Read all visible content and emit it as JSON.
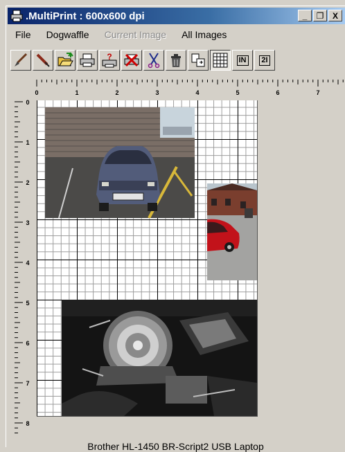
{
  "window": {
    "title": ".MultiPrint : 600x600 dpi",
    "minimize_glyph": "_",
    "restore_glyph": "❐",
    "close_glyph": "X"
  },
  "menu": {
    "items": [
      {
        "label": "File",
        "enabled": true
      },
      {
        "label": "Dogwaffle",
        "enabled": true
      },
      {
        "label": "Current Image",
        "enabled": false
      },
      {
        "label": "All Images",
        "enabled": true
      }
    ]
  },
  "toolbar": {
    "buttons": [
      {
        "icon": "brush-icon"
      },
      {
        "icon": "pen-icon"
      },
      {
        "icon": "open-folder-icon"
      },
      {
        "icon": "printer-icon"
      },
      {
        "icon": "print-setup-icon"
      },
      {
        "icon": "cancel-print-icon"
      },
      {
        "icon": "scissors-icon"
      },
      {
        "icon": "trash-icon"
      },
      {
        "icon": "move-icon"
      },
      {
        "icon": "grid-icon",
        "pressed": true
      },
      {
        "icon": "units-inch-icon",
        "label": "IN"
      },
      {
        "icon": "pages-icon",
        "label": "2I"
      }
    ]
  },
  "rulers": {
    "horizontal_labels": [
      "0",
      "1",
      "2",
      "3",
      "4",
      "5",
      "6",
      "7"
    ],
    "vertical_labels": [
      "0",
      "1",
      "2",
      "3",
      "4",
      "5",
      "6",
      "7",
      "8"
    ]
  },
  "images": [
    {
      "name": "car-photo",
      "description": "blue car parked by brick wall"
    },
    {
      "name": "red-car-photo",
      "description": "red car near buildings"
    },
    {
      "name": "engine-photo",
      "description": "motorcycle engine close-up"
    }
  ],
  "status": {
    "printer": "Brother HL-1450 BR-Script2 USB Laptop"
  },
  "colors": {
    "titlebar_start": "#0a246a",
    "titlebar_end": "#a6caf0",
    "window_bg": "#d4d0c8",
    "grid_major": "#000000",
    "grid_minor": "#9a9a9a"
  }
}
